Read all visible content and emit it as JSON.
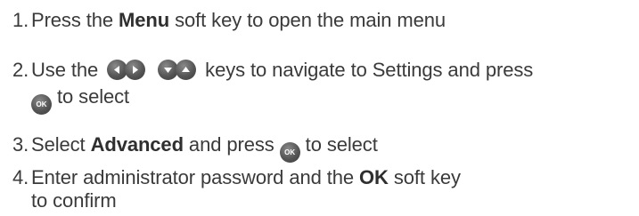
{
  "steps": [
    {
      "number": "1.",
      "pre": "Press the ",
      "bold": "Menu",
      "post": " soft key to open the main menu"
    },
    {
      "number": "2.",
      "pre": "Use the",
      "post": "keys to navigate to Settings and press",
      "line2_post": "to select",
      "icons": [
        "left-arrow-key-icon",
        "right-arrow-key-icon",
        "down-arrow-key-icon",
        "up-arrow-key-icon",
        "ok-key-icon"
      ]
    },
    {
      "number": "3.",
      "pre": "Select ",
      "bold": "Advanced",
      "post": " and press ",
      "tail": " to select"
    },
    {
      "number": "4.",
      "pre": "Enter administrator password and the ",
      "bold": "OK",
      "post": " soft key",
      "line2": "to confirm"
    }
  ],
  "ok_key_label": "OK",
  "colors": {
    "text": "#3a3a3a",
    "key": "#555555"
  }
}
